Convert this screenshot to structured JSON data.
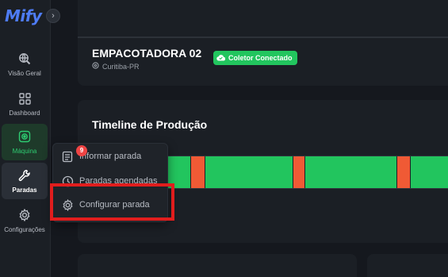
{
  "brand": {
    "logo": "Mify",
    "collapse_icon": "›"
  },
  "sidebar": {
    "items": [
      {
        "label": "Visão Geral",
        "icon": "globe-search-icon"
      },
      {
        "label": "Dashboard",
        "icon": "grid-icon"
      },
      {
        "label": "Máquina",
        "icon": "machine-icon"
      },
      {
        "label": "Paradas",
        "icon": "wrench-icon"
      },
      {
        "label": "Configurações",
        "icon": "gear-icon"
      }
    ]
  },
  "machine": {
    "name": "EMPACOTADORA 02",
    "status": "Coletor Conectado",
    "location": "Curitiba-PR"
  },
  "timeline": {
    "title": "Timeline de Produção",
    "colors": {
      "running": "#22c55e",
      "stopped": "#f05a35"
    },
    "stops": [
      {
        "start": 0.305,
        "end": 0.345
      },
      {
        "start": 0.58,
        "end": 0.615
      },
      {
        "start": 0.86,
        "end": 0.9
      }
    ]
  },
  "menu": {
    "items": [
      {
        "label": "Informar parada",
        "badge": "9"
      },
      {
        "label": "Paradas agendadas"
      },
      {
        "label": "Configurar parada"
      }
    ]
  }
}
